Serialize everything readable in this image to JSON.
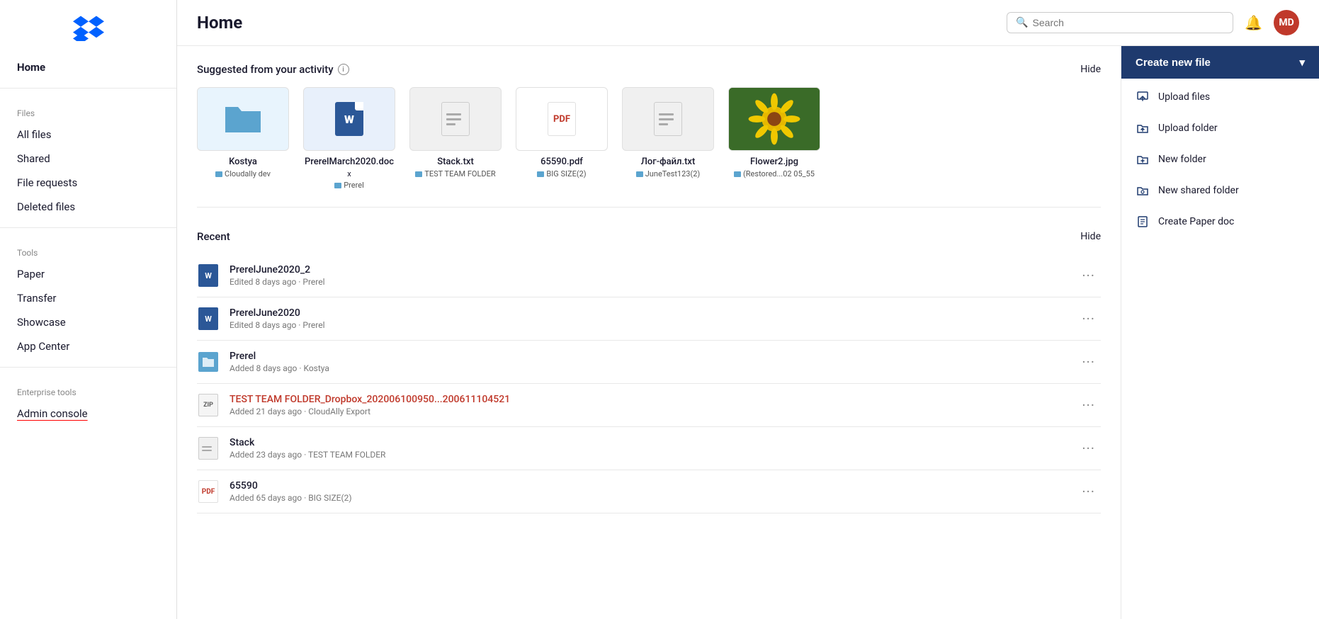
{
  "app": {
    "logo_alt": "Dropbox Logo"
  },
  "sidebar": {
    "home_label": "Home",
    "files_section": "Files",
    "nav_items": [
      {
        "id": "all-files",
        "label": "All files",
        "active": false
      },
      {
        "id": "shared",
        "label": "Shared",
        "active": false
      },
      {
        "id": "file-requests",
        "label": "File requests",
        "active": false
      },
      {
        "id": "deleted-files",
        "label": "Deleted files",
        "active": false
      }
    ],
    "tools_section": "Tools",
    "tool_items": [
      {
        "id": "paper",
        "label": "Paper",
        "active": false
      },
      {
        "id": "transfer",
        "label": "Transfer",
        "active": false
      },
      {
        "id": "showcase",
        "label": "Showcase",
        "active": false
      },
      {
        "id": "app-center",
        "label": "App Center",
        "active": false
      }
    ],
    "enterprise_section": "Enterprise tools",
    "enterprise_items": [
      {
        "id": "admin-console",
        "label": "Admin console",
        "active": false,
        "underline": true
      }
    ]
  },
  "header": {
    "title": "Home",
    "search_placeholder": "Search",
    "avatar_initials": "MD"
  },
  "suggested": {
    "section_title": "Suggested from your activity",
    "hide_label": "Hide",
    "items": [
      {
        "id": "kostya",
        "name": "Kostya",
        "location": "Cloudally dev",
        "type": "folder",
        "folder_color": "teal"
      },
      {
        "id": "prerel-march",
        "name": "PrerelMarch2020.doc",
        "location": "Prerel",
        "name_line2": "x",
        "type": "word"
      },
      {
        "id": "stack-txt",
        "name": "Stack.txt",
        "location": "TEST TEAM FOLDER",
        "type": "txt"
      },
      {
        "id": "65590-pdf",
        "name": "65590.pdf",
        "location": "BIG SIZE(2)",
        "type": "pdf"
      },
      {
        "id": "log-file",
        "name": "Лог-файл.txt",
        "location": "JuneTest123(2)",
        "type": "txt"
      },
      {
        "id": "flower2",
        "name": "Flower2.jpg",
        "location": "(Restored...02 05_55",
        "type": "image"
      }
    ]
  },
  "recent": {
    "section_title": "Recent",
    "hide_label": "Hide",
    "items": [
      {
        "id": "prerel-june-2",
        "name": "PrerelJune2020_2",
        "meta": "Edited 8 days ago · Prerel",
        "type": "word",
        "name_color": "normal"
      },
      {
        "id": "prerel-june",
        "name": "PrerelJune2020",
        "meta": "Edited 8 days ago · Prerel",
        "type": "word",
        "name_color": "normal"
      },
      {
        "id": "prerel-folder",
        "name": "Prerel",
        "meta": "Added 8 days ago · Kostya",
        "type": "folder",
        "name_color": "normal"
      },
      {
        "id": "test-team-folder",
        "name": "TEST TEAM FOLDER_Dropbox_202006100950...200611104521",
        "meta": "Added 21 days ago · CloudAlly Export",
        "type": "zip",
        "name_color": "red"
      },
      {
        "id": "stack",
        "name": "Stack",
        "meta": "Added 23 days ago · TEST TEAM FOLDER",
        "type": "txt",
        "name_color": "normal"
      },
      {
        "id": "65590",
        "name": "65590",
        "meta": "Added 65 days ago · BIG SIZE(2)",
        "type": "pdf",
        "name_color": "normal"
      }
    ]
  },
  "actions": {
    "create_label": "Create new file",
    "dropdown_icon": "▾",
    "items": [
      {
        "id": "upload-files",
        "label": "Upload files",
        "icon": "upload-file"
      },
      {
        "id": "upload-folder",
        "label": "Upload folder",
        "icon": "upload-folder"
      },
      {
        "id": "new-folder",
        "label": "New folder",
        "icon": "new-folder"
      },
      {
        "id": "new-shared-folder",
        "label": "New shared folder",
        "icon": "new-shared-folder"
      },
      {
        "id": "create-paper-doc",
        "label": "Create Paper doc",
        "icon": "paper-doc"
      }
    ]
  }
}
